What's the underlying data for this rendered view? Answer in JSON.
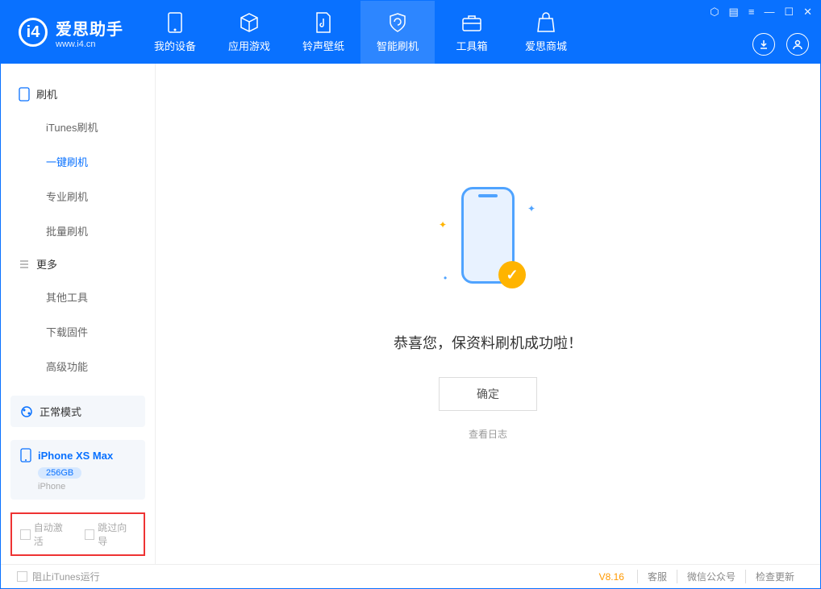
{
  "app": {
    "title": "爱思助手",
    "url": "www.i4.cn"
  },
  "tabs": [
    {
      "label": "我的设备"
    },
    {
      "label": "应用游戏"
    },
    {
      "label": "铃声壁纸"
    },
    {
      "label": "智能刷机"
    },
    {
      "label": "工具箱"
    },
    {
      "label": "爱思商城"
    }
  ],
  "sidebar": {
    "section1_title": "刷机",
    "items1": [
      {
        "label": "iTunes刷机"
      },
      {
        "label": "一键刷机"
      },
      {
        "label": "专业刷机"
      },
      {
        "label": "批量刷机"
      }
    ],
    "section2_title": "更多",
    "items2": [
      {
        "label": "其他工具"
      },
      {
        "label": "下载固件"
      },
      {
        "label": "高级功能"
      }
    ]
  },
  "mode_box": {
    "label": "正常模式"
  },
  "device": {
    "name": "iPhone XS Max",
    "storage": "256GB",
    "type": "iPhone"
  },
  "checkboxes": {
    "auto_activate": "自动激活",
    "skip_guide": "跳过向导"
  },
  "main": {
    "success_msg": "恭喜您，保资料刷机成功啦！",
    "ok": "确定",
    "log_link": "查看日志"
  },
  "statusbar": {
    "block_itunes": "阻止iTunes运行",
    "version": "V8.16",
    "links": [
      "客服",
      "微信公众号",
      "检查更新"
    ]
  }
}
